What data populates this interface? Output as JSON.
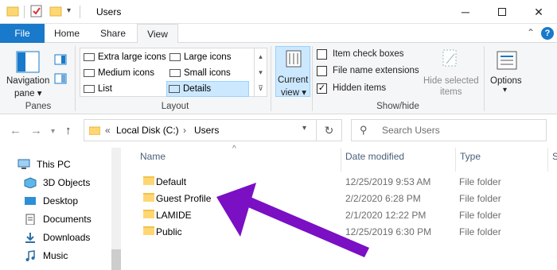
{
  "window": {
    "title": "Users",
    "controls": [
      "minimize",
      "maximize",
      "close"
    ]
  },
  "ribbon_tabs": {
    "file": "File",
    "home": "Home",
    "share": "Share",
    "view": "View",
    "active": "View"
  },
  "ribbon": {
    "panes": {
      "navigation_pane_line1": "Navigation",
      "navigation_pane_line2": "pane ▾",
      "group_label": "Panes"
    },
    "layout": {
      "items": [
        {
          "label": "Extra large icons",
          "selected": false
        },
        {
          "label": "Large icons",
          "selected": false
        },
        {
          "label": "Medium icons",
          "selected": false
        },
        {
          "label": "Small icons",
          "selected": false
        },
        {
          "label": "List",
          "selected": false
        },
        {
          "label": "Details",
          "selected": true
        }
      ],
      "group_label": "Layout"
    },
    "current_view": {
      "line1": "Current",
      "line2": "view ▾"
    },
    "show_hide": {
      "checkboxes": [
        {
          "label": "Item check boxes",
          "checked": false
        },
        {
          "label": "File name extensions",
          "checked": false
        },
        {
          "label": "Hidden items",
          "checked": true
        }
      ],
      "hide_selected_line1": "Hide selected",
      "hide_selected_line2": "items",
      "group_label": "Show/hide"
    },
    "options": {
      "label": "Options",
      "caret": "▾"
    }
  },
  "address_bar": {
    "prefix": "«",
    "segments": [
      "Local Disk (C:)",
      "Users"
    ],
    "separator": "›",
    "search_placeholder": "Search Users"
  },
  "nav_pane": {
    "items": [
      {
        "label": "This PC",
        "icon": "computer-icon"
      },
      {
        "label": "3D Objects",
        "icon": "cube-icon"
      },
      {
        "label": "Desktop",
        "icon": "desktop-icon"
      },
      {
        "label": "Documents",
        "icon": "documents-icon"
      },
      {
        "label": "Downloads",
        "icon": "downloads-icon"
      },
      {
        "label": "Music",
        "icon": "music-icon"
      }
    ]
  },
  "file_list": {
    "columns": {
      "name": "Name",
      "date": "Date modified",
      "type": "Type",
      "size": "S"
    },
    "rows": [
      {
        "name": "Default",
        "date": "12/25/2019 9:53 AM",
        "type": "File folder"
      },
      {
        "name": "Guest Profile",
        "date": "2/2/2020 6:28 PM",
        "type": "File folder"
      },
      {
        "name": "LAMIDE",
        "date": "2/1/2020 12:22 PM",
        "type": "File folder"
      },
      {
        "name": "Public",
        "date": "12/25/2019 6:30 PM",
        "type": "File folder"
      }
    ]
  },
  "colors": {
    "file_tab": "#1979ca",
    "folder": "#ffd772",
    "annotation_arrow": "#7a0fc4",
    "selected_layout": "#cce8ff"
  }
}
